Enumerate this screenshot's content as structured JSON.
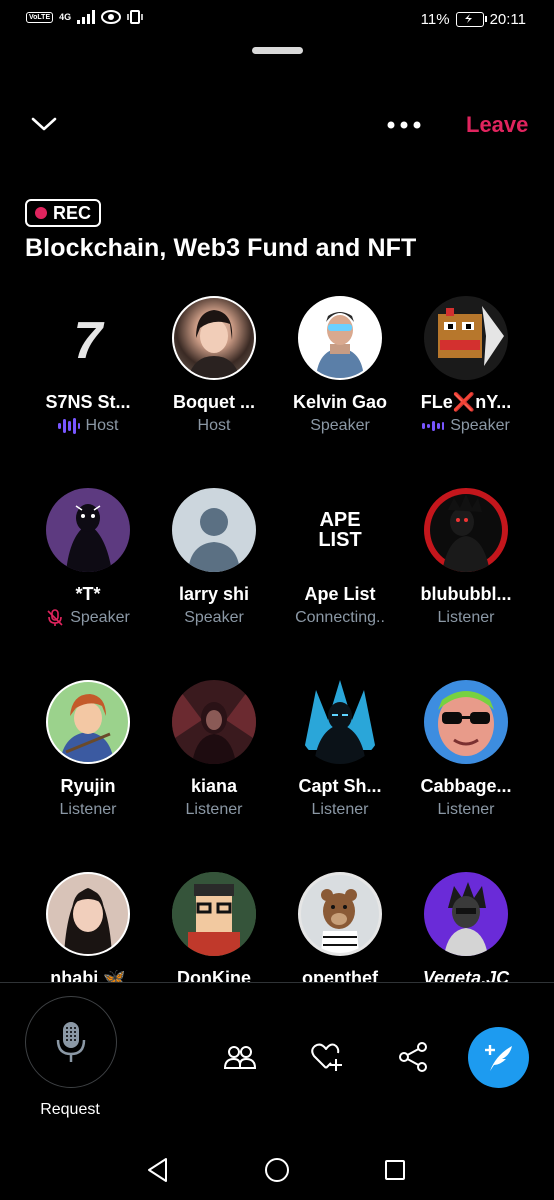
{
  "status_bar": {
    "network": "4G",
    "volte": "VoLTE",
    "battery": "11%",
    "time": "20:11"
  },
  "header": {
    "leave_label": "Leave",
    "accent_color": "#e0245e"
  },
  "space": {
    "rec_label": "REC",
    "title": "Blockchain, Web3 Fund and NFT"
  },
  "participants": [
    {
      "name": "S7NS St...",
      "role": "Host",
      "indicator": "speaking-bars"
    },
    {
      "name": "Boquet ...",
      "role": "Host",
      "indicator": ""
    },
    {
      "name": "Kelvin Gao",
      "role": "Speaker",
      "indicator": ""
    },
    {
      "name": "FLe❌nY...",
      "role": "Speaker",
      "indicator": "speaking-dots"
    },
    {
      "name": "*T*",
      "role": "Speaker",
      "indicator": "muted-mic"
    },
    {
      "name": "larry shi",
      "role": "Speaker",
      "indicator": ""
    },
    {
      "name": "Ape List",
      "role": "Connecting..",
      "indicator": ""
    },
    {
      "name": "blububbl...",
      "role": "Listener",
      "indicator": ""
    },
    {
      "name": "Ryujin",
      "role": "Listener",
      "indicator": ""
    },
    {
      "name": "kiana",
      "role": "Listener",
      "indicator": ""
    },
    {
      "name": "Capt Sh...",
      "role": "Listener",
      "indicator": ""
    },
    {
      "name": "Cabbage...",
      "role": "Listener",
      "indicator": ""
    },
    {
      "name": "nhabi 🦋",
      "role": "",
      "indicator": ""
    },
    {
      "name": "DonKine",
      "role": "",
      "indicator": ""
    },
    {
      "name": "openthef",
      "role": "",
      "indicator": ""
    },
    {
      "name": "Vegeta.JC",
      "role": "",
      "indicator": ""
    }
  ],
  "avatars": {
    "s7ns_text": "7",
    "apelist_text": "APE\nLIST"
  },
  "footer": {
    "request_label": "Request",
    "icons": [
      "mic-icon",
      "people-icon",
      "heart-plus-icon",
      "share-icon",
      "compose-icon"
    ],
    "fab_color": "#1d9bf0"
  }
}
